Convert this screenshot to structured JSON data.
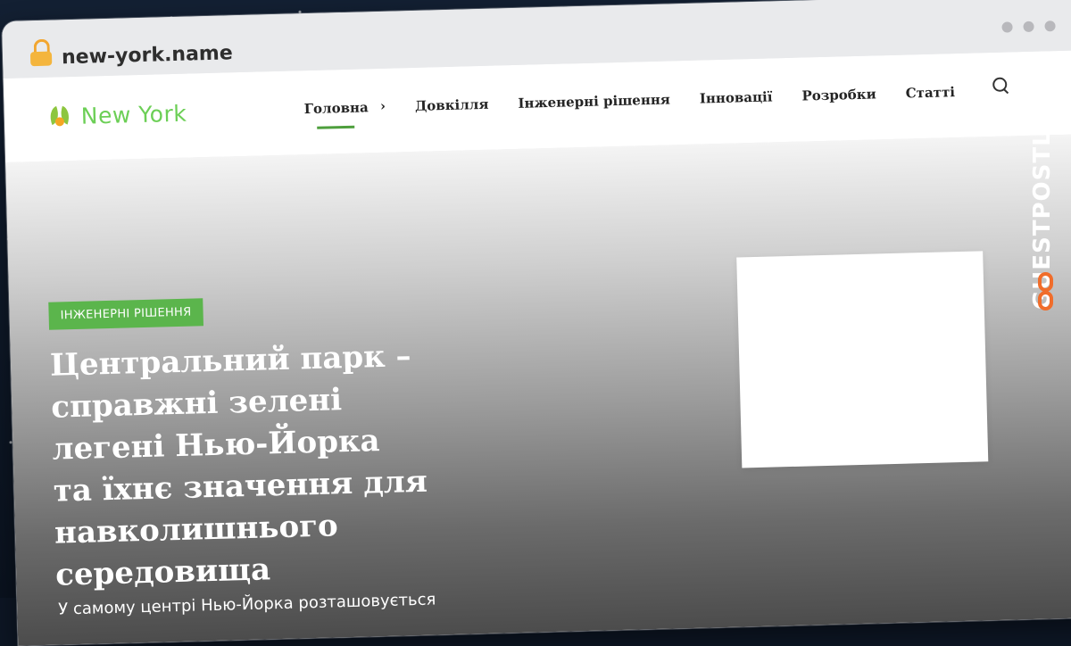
{
  "browser": {
    "url": "new-york.name"
  },
  "site": {
    "logo_text": "New York",
    "nav": [
      {
        "label": "Головна",
        "active": true,
        "has_arrow": true
      },
      {
        "label": "Довкілля"
      },
      {
        "label": "Інженерні рішення"
      },
      {
        "label": "Інновації"
      },
      {
        "label": "Розробки"
      },
      {
        "label": "Статті"
      }
    ]
  },
  "hero": {
    "category": "ІНЖЕНЕРНІ РІШЕННЯ",
    "title": "Центральний парк – справжні зелені легені Нью-Йорка та їхнє значення для навколишнього середовища",
    "excerpt": "У самому центрі Нью-Йорка розташовується"
  },
  "overlay": {
    "brand": "GUESTPOSTLINKS"
  },
  "colors": {
    "accent": "#5bb54c",
    "logo": "#6ccf56",
    "brand": "#f06d2b"
  },
  "icons": {
    "lock": "lock-icon",
    "search": "search-icon",
    "logo": "leaf-logo-icon",
    "brand": "chain-link-icon"
  }
}
